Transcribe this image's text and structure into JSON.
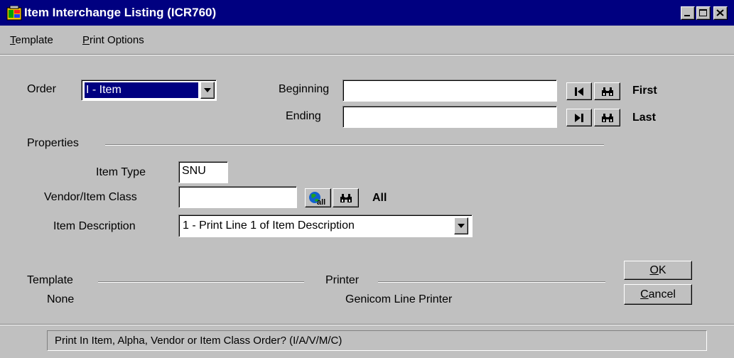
{
  "window": {
    "title": "Item Interchange Listing (ICR760)",
    "controls": {
      "minimize": "minimize-icon",
      "maximize": "maximize-icon",
      "close": "close-icon"
    },
    "colors": {
      "titlebar": "#000080",
      "face": "#c0c0c0",
      "selection": "#000080"
    }
  },
  "menu": {
    "items": [
      {
        "accel": "T",
        "rest": "emplate"
      },
      {
        "accel": "P",
        "rest": "rint Options"
      }
    ]
  },
  "order": {
    "label": "Order",
    "selected": "I - Item"
  },
  "range": {
    "beginning_label": "Beginning",
    "beginning_value": "",
    "ending_label": "Ending",
    "ending_value": "",
    "first_label": "First",
    "last_label": "Last"
  },
  "properties": {
    "heading": "Properties",
    "item_type_label": "Item Type",
    "item_type_value": "SNU",
    "vendor_class_label": "Vendor/Item Class",
    "vendor_class_value": "",
    "all_label": "All",
    "all_icon_text": "all",
    "item_desc_label": "Item Description",
    "item_desc_selected": "1 - Print Line 1 of Item Description"
  },
  "template": {
    "heading": "Template",
    "value": "None"
  },
  "printer": {
    "heading": "Printer",
    "value": "Genicom Line Printer"
  },
  "buttons": {
    "ok_accel": "O",
    "ok_rest": "K",
    "cancel_accel": "C",
    "cancel_rest": "ancel"
  },
  "status": {
    "text": "Print In Item, Alpha, Vendor or Item Class Order? (I/A/V/M/C)"
  }
}
